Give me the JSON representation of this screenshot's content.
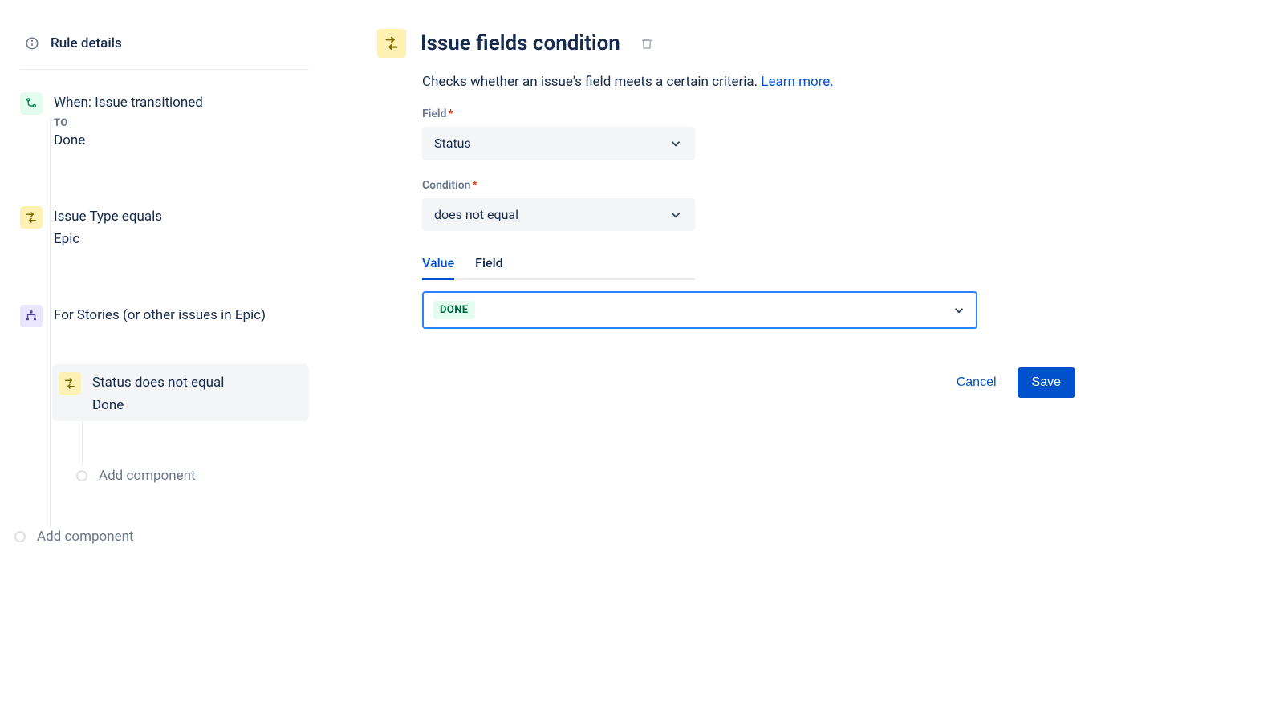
{
  "sidebar": {
    "rule_details_label": "Rule details",
    "nodes": [
      {
        "title": "When: Issue transitioned",
        "sub_label": "TO",
        "value": "Done"
      },
      {
        "title": "Issue Type equals",
        "value": "Epic"
      },
      {
        "title": "For Stories (or other issues in Epic)"
      },
      {
        "title": "Status does not equal",
        "value": "Done"
      }
    ],
    "add_component_label": "Add component"
  },
  "main": {
    "title": "Issue fields condition",
    "description": "Checks whether an issue's field meets a certain criteria. ",
    "learn_more": "Learn more.",
    "form": {
      "field_label": "Field",
      "field_value": "Status",
      "condition_label": "Condition",
      "condition_value": "does not equal",
      "tabs": {
        "value": "Value",
        "field": "Field"
      },
      "selected_status": "DONE"
    },
    "actions": {
      "cancel": "Cancel",
      "save": "Save"
    }
  }
}
